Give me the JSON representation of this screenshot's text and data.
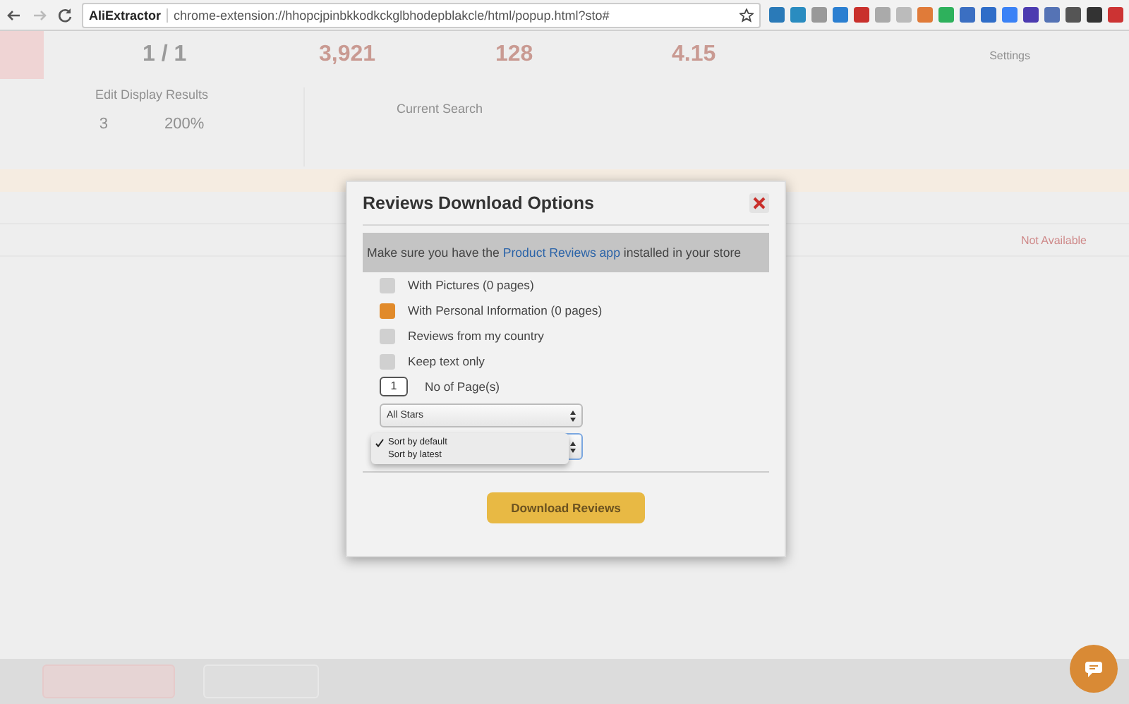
{
  "browser": {
    "site_name": "AliExtractor",
    "url": "chrome-extension://hhopcjpinbkkodkckglbhodepblakcle/html/popup.html?sto#"
  },
  "header": {
    "stats": [
      "1 / 1",
      "3,921",
      "128",
      "4.15"
    ],
    "settings_label": "Settings",
    "display_title": "Edit Display Results",
    "display_count": "3",
    "display_zoom": "200%",
    "search_title": "Current Search"
  },
  "table": {
    "rows": [
      {
        "status": "Not Available"
      }
    ]
  },
  "dialog": {
    "title": "Reviews Download Options",
    "notice": {
      "before": "Make sure you have the",
      "link": "Product Reviews app",
      "after": "installed in your store"
    },
    "options": [
      {
        "label": "With Pictures (0 pages)",
        "checked": false
      },
      {
        "label": "With Personal Information (0 pages)",
        "checked": true
      },
      {
        "label": "Reviews from my country",
        "checked": false
      },
      {
        "label": "Keep text only",
        "checked": false
      }
    ],
    "pages": {
      "value": "1",
      "label": "No of Page(s)"
    },
    "stars_select": "All Stars",
    "sort_dropdown": {
      "expanded": true,
      "options": [
        {
          "label": "Sort by default",
          "selected": true
        },
        {
          "label": "Sort by latest",
          "selected": false
        }
      ]
    },
    "button": "Download Reviews"
  }
}
